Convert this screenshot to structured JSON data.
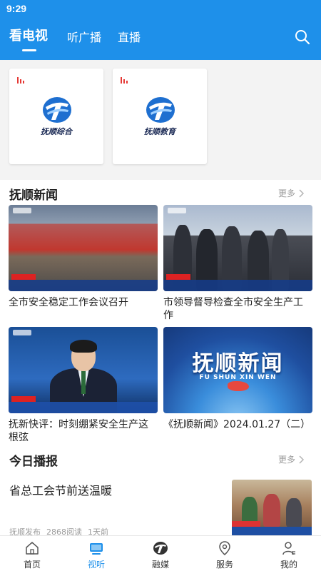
{
  "status_bar": {
    "time": "9:29"
  },
  "header": {
    "tabs": [
      {
        "label": "看电视",
        "active": true
      },
      {
        "label": "听广播",
        "active": false
      },
      {
        "label": "直播",
        "active": false
      }
    ],
    "search_icon": "search-icon"
  },
  "channels": [
    {
      "name": "抚顺综合",
      "icon": "live-bars-icon"
    },
    {
      "name": "抚顺教育",
      "icon": "live-bars-icon"
    }
  ],
  "news_section": {
    "title": "抚顺新闻",
    "more_label": "更多",
    "items": [
      {
        "title": "全市安全稳定工作会议召开"
      },
      {
        "title": "市领导督导检查全市安全生产工作"
      },
      {
        "title": "抚新快评：时刻绷紧安全生产这根弦"
      },
      {
        "title": "《抚顺新闻》2024.01.27（二）",
        "thumb_title": "抚顺新闻",
        "thumb_subtitle": "FU SHUN XIN WEN"
      }
    ]
  },
  "today_section": {
    "title": "今日播报",
    "more_label": "更多",
    "item": {
      "title": "省总工会节前送温暖",
      "source": "抚顺发布",
      "reads": "2868阅读",
      "time": "1天前"
    }
  },
  "bottom_nav": [
    {
      "label": "首页",
      "icon": "home-icon",
      "active": false
    },
    {
      "label": "视听",
      "icon": "tv-icon",
      "active": true
    },
    {
      "label": "融媒",
      "icon": "media-logo-icon",
      "active": false
    },
    {
      "label": "服务",
      "icon": "location-pin-icon",
      "active": false
    },
    {
      "label": "我的",
      "icon": "user-icon",
      "active": false
    }
  ],
  "colors": {
    "brand_blue": "#1e90ea",
    "text_gray": "#9b9b9b",
    "live_red": "#e53935"
  }
}
